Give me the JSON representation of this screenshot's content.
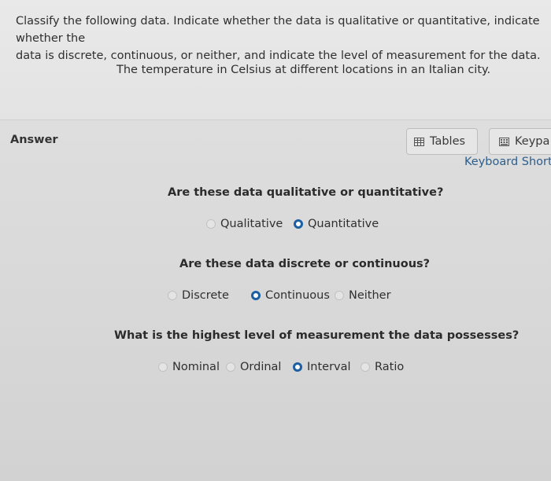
{
  "question": {
    "prompt": "Classify the following data. Indicate whether the data is qualitative or quantitative, indicate whether the\ndata is discrete, continuous, or neither, and indicate the level of measurement for the data.",
    "detail": "The temperature in Celsius at different locations in an Italian city."
  },
  "answer": {
    "label": "Answer",
    "tables_button": "Tables",
    "keypad_button": "Keypa",
    "shortcuts_link": "Keyboard Shortc"
  },
  "q1": {
    "title": "Are these data qualitative or quantitative?",
    "options": [
      "Qualitative",
      "Quantitative"
    ],
    "selected": "Quantitative"
  },
  "q2": {
    "title": "Are these data discrete or continuous?",
    "options": [
      "Discrete",
      "Continuous",
      "Neither"
    ],
    "selected": "Continuous"
  },
  "q3": {
    "title": "What is the highest level of measurement the data possesses?",
    "options": [
      "Nominal",
      "Ordinal",
      "Interval",
      "Ratio"
    ],
    "selected": "Interval"
  },
  "colors": {
    "radio_selected": "#1d5fa3",
    "link": "#2e5d8a"
  }
}
